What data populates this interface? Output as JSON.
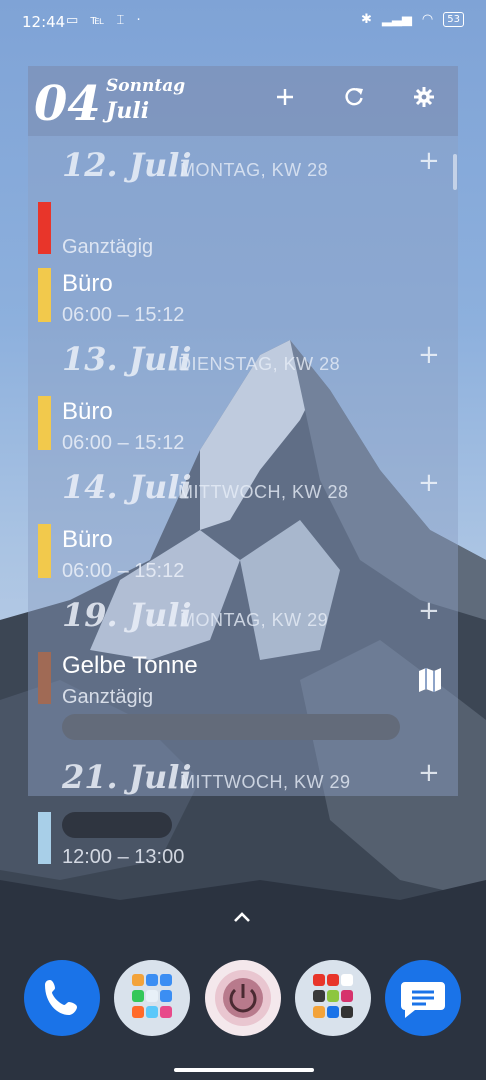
{
  "status_bar": {
    "time": "12:44",
    "battery": "53"
  },
  "widget": {
    "day_number": "04",
    "weekday": "Sonntag",
    "month": "Juli",
    "days": [
      {
        "date": "12. Juli",
        "weekday_week": "MONTAG,  KW 28",
        "events": [
          {
            "title": "",
            "sub": "Ganztägig",
            "color": "#e8352a"
          },
          {
            "title": "Büro",
            "sub": "06:00 – 15:12",
            "color": "#f2c94c"
          }
        ]
      },
      {
        "date": "13. Juli",
        "weekday_week": "DIENSTAG,  KW 28",
        "events": [
          {
            "title": "Büro",
            "sub": "06:00 – 15:12",
            "color": "#f2c94c"
          }
        ]
      },
      {
        "date": "14. Juli",
        "weekday_week": "MITTWOCH,  KW 28",
        "events": [
          {
            "title": "Büro",
            "sub": "06:00 – 15:12",
            "color": "#f2c94c"
          }
        ]
      },
      {
        "date": "19. Juli",
        "weekday_week": "MONTAG,  KW 29",
        "events": [
          {
            "title": "Gelbe Tonne",
            "sub": "Ganztägig",
            "color": "#a06a55"
          }
        ]
      },
      {
        "date": "21. Juli",
        "weekday_week": "MITTWOCH,  KW 29",
        "events": [
          {
            "title": "",
            "sub": "12:00 – 13:00",
            "color": "#a8cfe8"
          }
        ]
      }
    ]
  },
  "dock": {
    "icons": [
      "phone-icon",
      "app-folder-1",
      "power-app-icon",
      "app-folder-2",
      "messages-icon"
    ]
  }
}
